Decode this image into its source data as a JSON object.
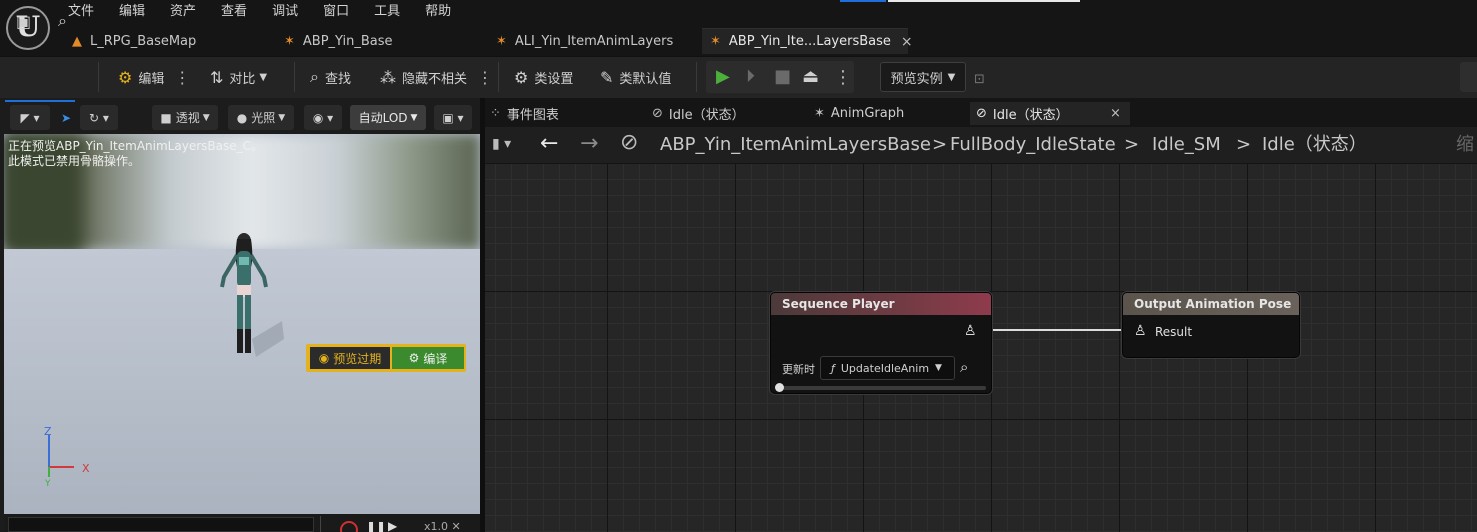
{
  "menu": {
    "items": [
      "文件",
      "编辑",
      "资产",
      "查看",
      "调试",
      "窗口",
      "工具",
      "帮助"
    ],
    "logo_letter": "U"
  },
  "doc_tabs": [
    {
      "label": "L_RPG_BaseMap",
      "icon": "level-icon"
    },
    {
      "label": "ABP_Yin_Base",
      "icon": "anim-blueprint-icon"
    },
    {
      "label": "ALI_Yin_ItemAnimLayers",
      "icon": "anim-layer-interface-icon"
    },
    {
      "label": "ABP_Yin_Ite...LayersBase",
      "icon": "anim-blueprint-icon",
      "active": true,
      "close": "×"
    }
  ],
  "toolbar": {
    "compile_label": "编辑",
    "diff_label": "对比",
    "find_label": "查找",
    "hide_unrelated_label": "隐藏不相关",
    "class_settings_label": "类设置",
    "class_defaults_label": "类默认值",
    "preview_instance_label": "预览实例"
  },
  "viewport": {
    "perspective_label": "透视",
    "lighting_label": "光照",
    "lod_label": "自动LOD",
    "preview_line1": "正在预览ABP_Yin_ItemAnimLayersBase_C。",
    "preview_line2": "此模式已禁用骨骼操作。",
    "stale_label": "预览过期",
    "compile_label": "编译",
    "axis_z": "Z",
    "axis_x": "X",
    "axis_y": "Y",
    "speed": "x1.0 ✕"
  },
  "graph_tabs": [
    {
      "label": "事件图表",
      "icon": "event-graph-icon"
    },
    {
      "label": "Idle（状态）",
      "icon": "state-icon"
    },
    {
      "label": "AnimGraph",
      "icon": "anim-graph-icon"
    },
    {
      "label": "Idle（状态）",
      "icon": "state-icon",
      "active": true,
      "close": "×"
    }
  ],
  "breadcrumb": {
    "items": [
      "ABP_Yin_ItemAnimLayersBase",
      "FullBody_IdleState",
      "Idle_SM",
      "Idle（状态）"
    ],
    "separator": ">",
    "zoom_label": "缩"
  },
  "nodes": {
    "sequence_player": {
      "title": "Sequence Player",
      "update_label": "更新时",
      "function_name": "UpdateIdleAnim",
      "function_symbol": "ƒ",
      "play_rate": 0.0
    },
    "output_pose": {
      "title": "Output Animation Pose",
      "pin_label": "Result"
    }
  },
  "colors": {
    "accent_blue": "#1e6fd9",
    "play_green": "#4caf3c",
    "stale_yellow": "#e4b21c",
    "compile_green": "#3b8a2e",
    "sequence_header": "#8e3b4d",
    "output_header": "#6a625a"
  }
}
